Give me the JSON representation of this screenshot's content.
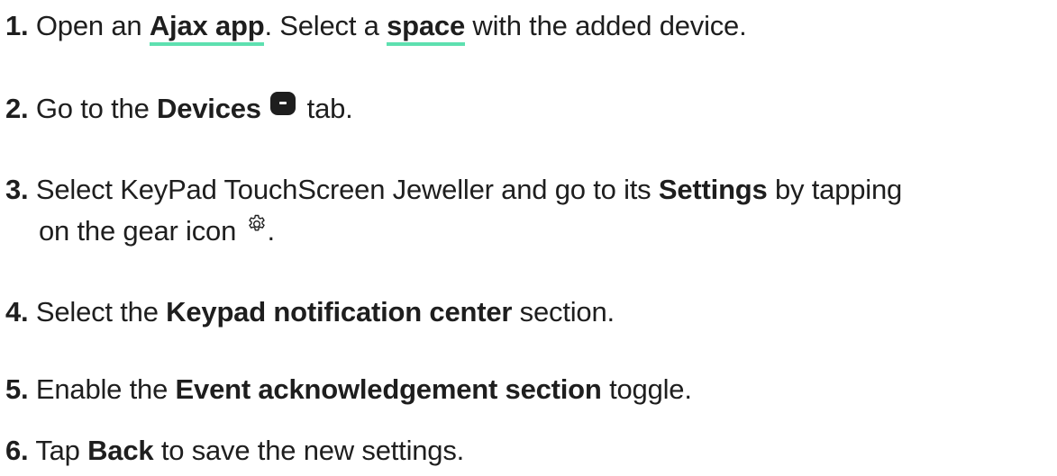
{
  "steps": [
    {
      "number": "1.",
      "t1": "Open an ",
      "link1": "Ajax app",
      "t2": ". Select a ",
      "link2": "space",
      "t3": " with the added device."
    },
    {
      "number": "2.",
      "t1": "Go to the ",
      "bold1": "Devices",
      "t2": " tab.",
      "icon": "devices-tab-icon"
    },
    {
      "number": "3.",
      "t1": "Select KeyPad TouchScreen Jeweller and go to its ",
      "bold1": "Settings",
      "t2": " by tapping",
      "line2": "on the gear icon ",
      "t3": ".",
      "icon": "gear-icon"
    },
    {
      "number": "4.",
      "t1": "Select the ",
      "bold1": "Keypad notification center",
      "t2": " section."
    },
    {
      "number": "5.",
      "t1": "Enable the ",
      "bold1": "Event acknowledgement section",
      "t2": " toggle."
    },
    {
      "number": "6.",
      "t1": "Tap ",
      "bold1": "Back",
      "t2": " to save the new settings."
    }
  ],
  "colors": {
    "text": "#1e1e1e",
    "link_underline": "#5ee0b0"
  }
}
